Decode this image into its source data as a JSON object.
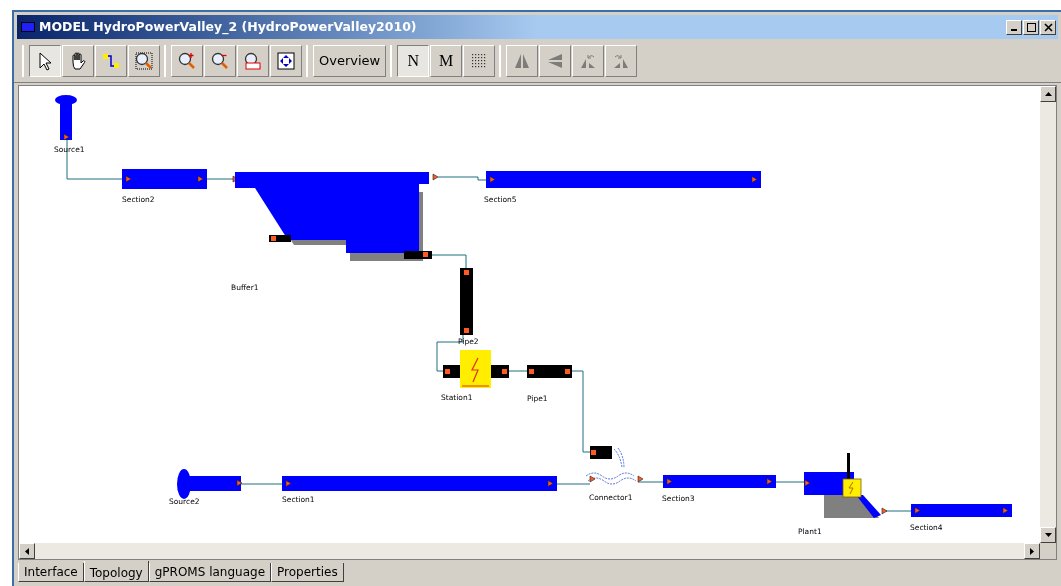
{
  "window": {
    "title": "MODEL HydroPowerValley_2 (HydroPowerValley2010)"
  },
  "toolbar": {
    "groups": [
      [
        {
          "kind": "pointer",
          "selected": true,
          "disabled": false
        },
        {
          "kind": "hand",
          "selected": false,
          "disabled": false
        },
        {
          "kind": "connect",
          "selected": false,
          "disabled": false
        },
        {
          "kind": "zoombox",
          "selected": false,
          "disabled": false
        }
      ],
      [
        {
          "kind": "zoomin",
          "selected": false,
          "disabled": false
        },
        {
          "kind": "zoomout",
          "selected": false,
          "disabled": false
        },
        {
          "kind": "zoom100",
          "selected": false,
          "disabled": false
        },
        {
          "kind": "fit",
          "selected": false,
          "disabled": false
        }
      ],
      [
        {
          "kind": "text",
          "label": "Overview",
          "selected": false,
          "disabled": false
        }
      ],
      [
        {
          "kind": "letter",
          "label": "N",
          "selected": true,
          "disabled": false
        },
        {
          "kind": "letter",
          "label": "M",
          "selected": false,
          "disabled": false
        },
        {
          "kind": "grid",
          "selected": false,
          "disabled": false
        }
      ],
      [
        {
          "kind": "fliph",
          "selected": false,
          "disabled": true
        },
        {
          "kind": "flipv",
          "selected": false,
          "disabled": true
        },
        {
          "kind": "rotl",
          "selected": false,
          "disabled": true
        },
        {
          "kind": "rotr",
          "selected": false,
          "disabled": true
        }
      ]
    ]
  },
  "diagram": {
    "nodes": [
      {
        "kind": "source",
        "label": "Source1"
      },
      {
        "kind": "section",
        "label": "Section2"
      },
      {
        "kind": "buffer",
        "label": "Buffer1"
      },
      {
        "kind": "section",
        "label": "Section5"
      },
      {
        "kind": "pipe",
        "label": "Pipe2"
      },
      {
        "kind": "station",
        "label": "Station1"
      },
      {
        "kind": "pipe",
        "label": "Pipe1"
      },
      {
        "kind": "source",
        "label": "Source2"
      },
      {
        "kind": "section",
        "label": "Section1"
      },
      {
        "kind": "connector",
        "label": "Connector1"
      },
      {
        "kind": "section",
        "label": "Section3"
      },
      {
        "kind": "plant",
        "label": "Plant1"
      },
      {
        "kind": "section",
        "label": "Section4"
      }
    ]
  },
  "tabs": [
    {
      "label": "Interface",
      "selected": false
    },
    {
      "label": "Topology",
      "selected": true
    },
    {
      "label": "gPROMS language",
      "selected": false
    },
    {
      "label": "Properties",
      "selected": false
    }
  ]
}
